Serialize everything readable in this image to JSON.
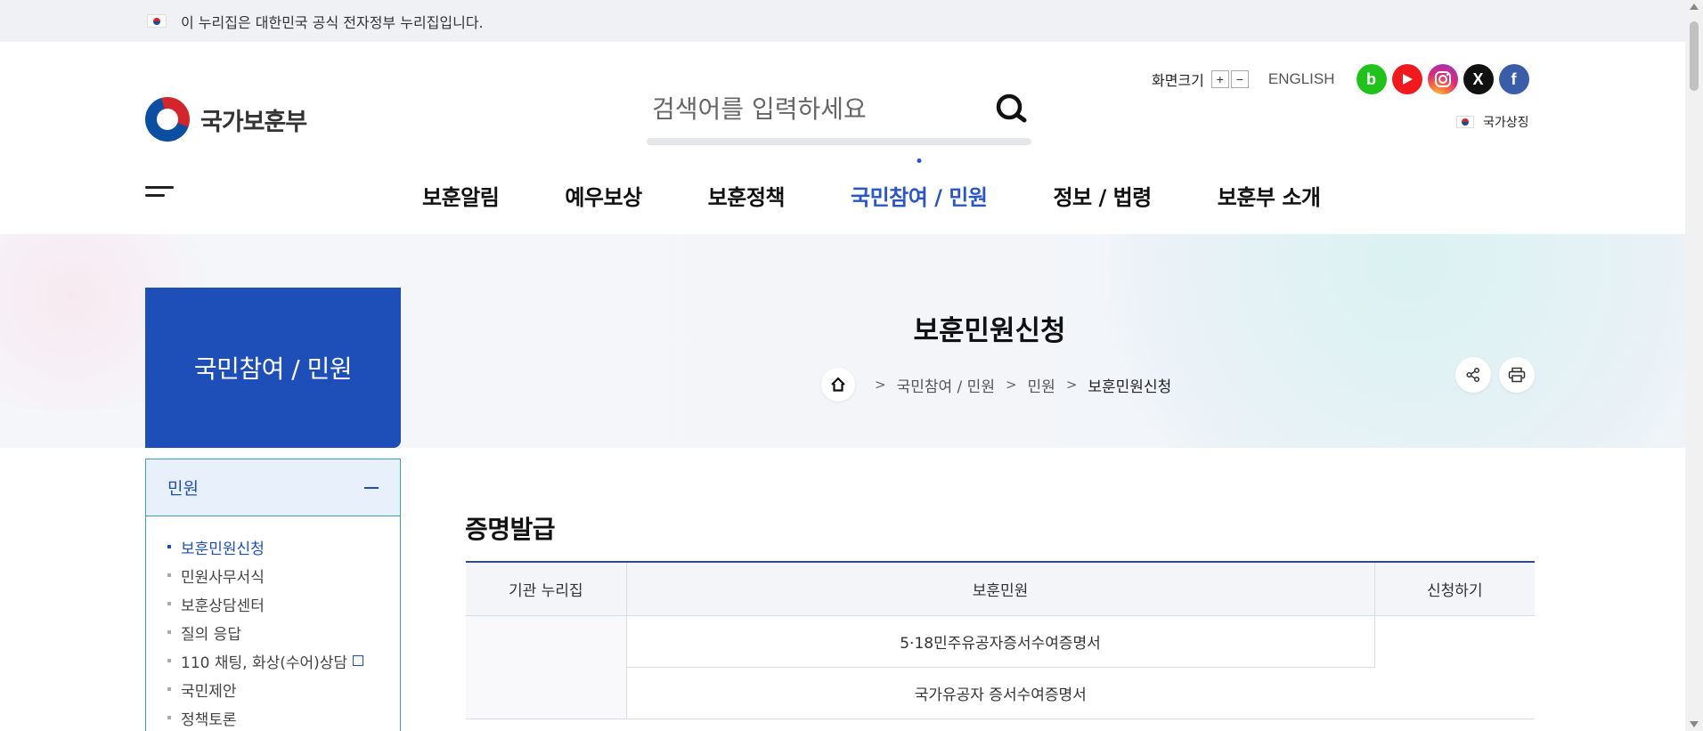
{
  "gov_banner": {
    "text": "이 누리집은 대한민국 공식 전자정부 누리집입니다."
  },
  "header": {
    "logo_text": "국가보훈부",
    "search": {
      "placeholder": "검색어를 입력하세요"
    },
    "util": {
      "font_size_label": "화면크기",
      "plus": "+",
      "minus": "−",
      "english": "ENGLISH",
      "sns": [
        {
          "name": "blog-icon",
          "glyph": "b"
        },
        {
          "name": "youtube-icon",
          "glyph": "▶"
        },
        {
          "name": "instagram-icon",
          "glyph": "◎"
        },
        {
          "name": "x-icon",
          "glyph": "X"
        },
        {
          "name": "facebook-icon",
          "glyph": "f"
        }
      ],
      "national_symbol": "국가상징"
    },
    "gnb": [
      {
        "label": "보훈알림",
        "active": false
      },
      {
        "label": "예우보상",
        "active": false
      },
      {
        "label": "보훈정책",
        "active": false
      },
      {
        "label": "국민참여 / 민원",
        "active": true
      },
      {
        "label": "정보 / 법령",
        "active": false
      },
      {
        "label": "보훈부 소개",
        "active": false
      }
    ]
  },
  "visual": {
    "page_title": "보훈민원신청",
    "breadcrumb": [
      "국민참여 / 민원",
      "민원",
      "보훈민원신청"
    ]
  },
  "sidebar": {
    "title": "국민참여 / 민원",
    "group": "민원",
    "items": [
      {
        "label": "보훈민원신청",
        "active": true
      },
      {
        "label": "민원사무서식",
        "active": false
      },
      {
        "label": "보훈상담센터",
        "active": false
      },
      {
        "label": "질의 응답",
        "active": false
      },
      {
        "label": "110 채팅, 화상(수어)상담",
        "active": false,
        "external": true
      },
      {
        "label": "국민제안",
        "active": false
      },
      {
        "label": "정책토론",
        "active": false
      }
    ]
  },
  "content": {
    "section_title": "증명발급",
    "table": {
      "headers": [
        "기관 누리집",
        "보훈민원",
        "신청하기"
      ],
      "rows": [
        [
          "",
          "5·18민주유공자증서수여증명서",
          ""
        ],
        [
          "",
          "국가유공자 증서수여증명서",
          ""
        ]
      ]
    }
  },
  "colors": {
    "brand": "#1e4fb8",
    "gnb_active": "#2a56c6",
    "table_top": "#2d4b8e"
  }
}
